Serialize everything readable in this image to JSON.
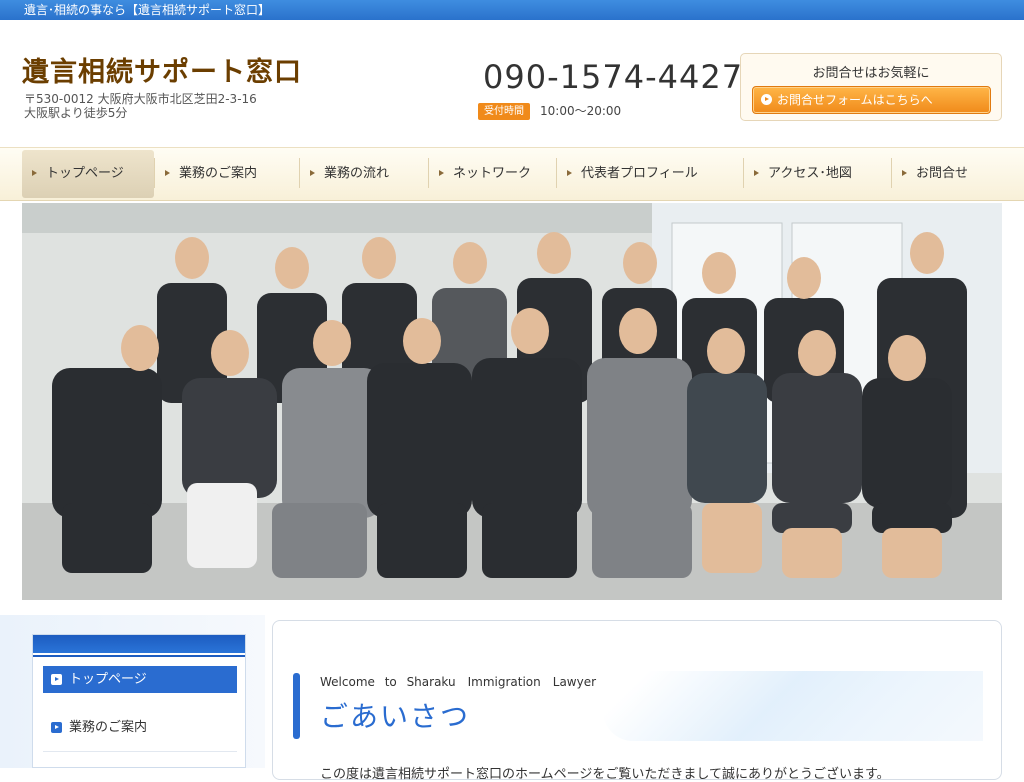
{
  "topbar": {
    "text": "遺言･相続の事なら【遺言相続サポート窓口】"
  },
  "header": {
    "site_title": "遺言相続サポート窓口",
    "address_line1": "〒530-0012 大阪府大阪市北区芝田2-3-16",
    "address_line2": "大阪駅より徒歩5分",
    "phone": "090-1574-4427",
    "hours_badge": "受付時間",
    "hours": "10:00～20:00",
    "contact_title": "お問合せはお気軽に",
    "contact_button": "お問合せフォームはこちらへ"
  },
  "nav": {
    "items": [
      {
        "label": "トップページ"
      },
      {
        "label": "業務のご案内"
      },
      {
        "label": "業務の流れ"
      },
      {
        "label": "ネットワーク"
      },
      {
        "label": "代表者プロフィール"
      },
      {
        "label": "アクセス･地図"
      },
      {
        "label": "お問合せ"
      }
    ]
  },
  "sidebar": {
    "items": [
      {
        "label": "トップページ"
      },
      {
        "label": "業務のご案内"
      }
    ]
  },
  "main": {
    "greeting_en": "Welcome to Sharaku　Immigration　Lawyer",
    "greeting_jp": "ごあいさつ",
    "body_text": "この度は遺言相続サポート窓口のホームページをご覧いただきまして誠にありがとうございます。"
  },
  "colors": {
    "accent": "#2a6cd0",
    "brand": "#6b3e00",
    "button": "#f08a1a"
  }
}
